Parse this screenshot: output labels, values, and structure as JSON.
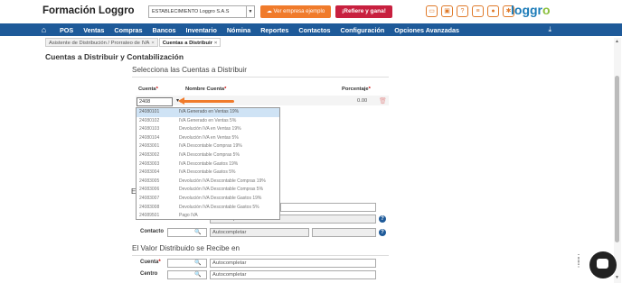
{
  "app": {
    "title": "Formación Loggro",
    "logo": "loggro"
  },
  "topbar": {
    "company_select": "ESTABLECIMIENTO Loggro S.A.S",
    "example_button": "Ver empresa ejemplo",
    "refer_button": "¡Refiere y gana!",
    "icons": [
      "chat-icon",
      "image-icon",
      "help-icon",
      "clipboard-icon",
      "user-icon",
      "gear-icon"
    ]
  },
  "nav": {
    "items": [
      "POS",
      "Ventas",
      "Compras",
      "Bancos",
      "Inventario",
      "Nómina",
      "Reportes",
      "Contactos",
      "Configuración",
      "Opciones Avanzadas"
    ]
  },
  "tabs": [
    {
      "label": "Asistente de Distribución / Prorrateo de IVA",
      "active": false
    },
    {
      "label": "Cuentas a Distribuir",
      "active": true
    }
  ],
  "page": {
    "title": "Cuentas a Distribuir y Contabilización"
  },
  "section1": {
    "title": "Selecciona las Cuentas a Distribuir",
    "col_cuenta": "Cuenta",
    "col_nombre": "Nombre Cuenta",
    "col_porcentaje": "Porcentaje",
    "required_mark": "*",
    "cuenta_value": "2408",
    "porcentaje_value": "0.00"
  },
  "dropdown": {
    "options": [
      {
        "code": "24080101",
        "name": "IVA Generado en Ventas 19%"
      },
      {
        "code": "24080102",
        "name": "IVA Generado en Ventas 5%"
      },
      {
        "code": "24080103",
        "name": "Devolución IVA en Ventas 19%"
      },
      {
        "code": "24080104",
        "name": "Devolución IVA en Ventas 5%"
      },
      {
        "code": "24083001",
        "name": "IVA Descontable Compras 19%"
      },
      {
        "code": "24083002",
        "name": "IVA Descontable Compras 5%"
      },
      {
        "code": "24083003",
        "name": "IVA Descontable Gastos 19%"
      },
      {
        "code": "24083004",
        "name": "IVA Descontable Gastos 5%"
      },
      {
        "code": "24083005",
        "name": "Devolución IVA Descontable Compras 19%"
      },
      {
        "code": "24083006",
        "name": "Devolución IVA Descontable Compras 5%"
      },
      {
        "code": "24083007",
        "name": "Devolución IVA Descontable Gastos 19%"
      },
      {
        "code": "24083008",
        "name": "Devolución IVA Descontable Gastos 5%"
      },
      {
        "code": "24089501",
        "name": "Pago IVA"
      }
    ]
  },
  "section2": {
    "title_partial": "El",
    "contacto_label": "Contacto",
    "autocomplete": "Autocompletar"
  },
  "section3": {
    "title": "El Valor Distribuido se Recibe en",
    "cuenta_label": "Cuenta",
    "centro_label": "Centro",
    "required_mark": "*",
    "autocomplete": "Autocompletar"
  }
}
